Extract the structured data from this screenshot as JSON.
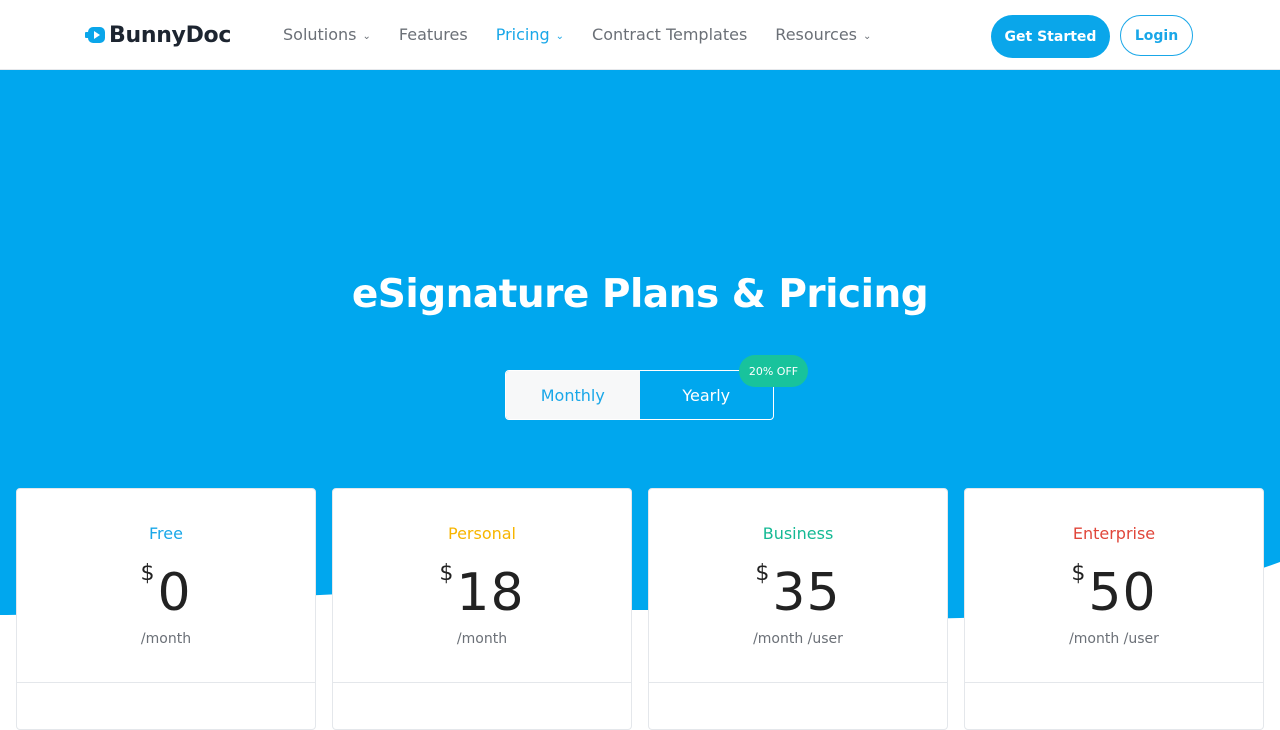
{
  "brand": {
    "name": "BunnyDoc",
    "accent": "#0aa6ea",
    "hero_color": "#00a7ee"
  },
  "nav": {
    "items": [
      {
        "label": "Solutions",
        "has_dropdown": true,
        "active": false
      },
      {
        "label": "Features",
        "has_dropdown": false,
        "active": false
      },
      {
        "label": "Pricing",
        "has_dropdown": true,
        "active": true
      },
      {
        "label": "Contract Templates",
        "has_dropdown": false,
        "active": false
      },
      {
        "label": "Resources",
        "has_dropdown": true,
        "active": false
      }
    ],
    "cta_label": "Get Started",
    "login_label": "Login"
  },
  "hero": {
    "title": "eSignature Plans & Pricing"
  },
  "billing_toggle": {
    "monthly_label": "Monthly",
    "yearly_label": "Yearly",
    "selected": "Monthly",
    "badge": "20% OFF",
    "badge_color": "#18c39c"
  },
  "plans": [
    {
      "name": "Free",
      "currency": "$",
      "amount": "0",
      "period": "/month",
      "color": "#19a7e8"
    },
    {
      "name": "Personal",
      "currency": "$",
      "amount": "18",
      "period": "/month",
      "color": "#f7b500"
    },
    {
      "name": "Business",
      "currency": "$",
      "amount": "35",
      "period": "/month /user",
      "color": "#14b994"
    },
    {
      "name": "Enterprise",
      "currency": "$",
      "amount": "50",
      "period": "/month /user",
      "color": "#e0463a"
    }
  ]
}
